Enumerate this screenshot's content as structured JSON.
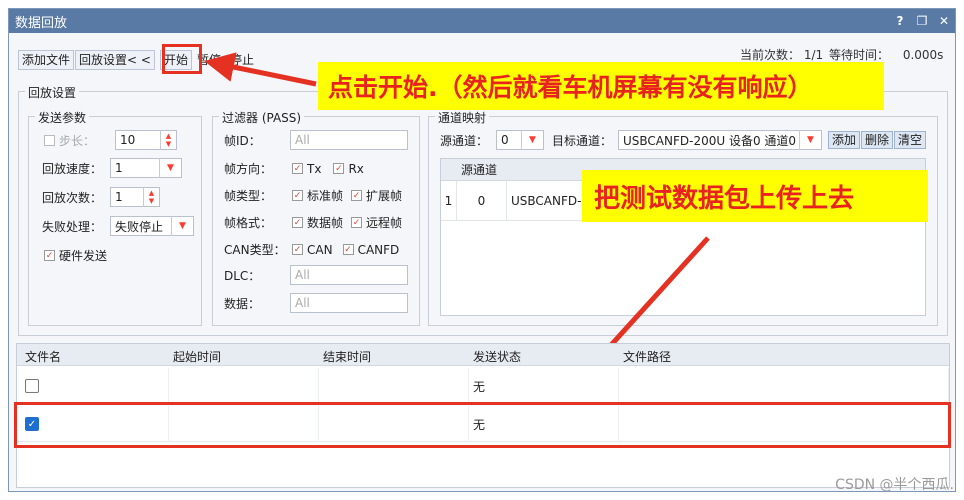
{
  "window": {
    "title": "数据回放",
    "help": "?",
    "restore": "❐",
    "close": "✕"
  },
  "toolbar": {
    "add_file": "添加文件",
    "replay_settings": "回放设置< <",
    "start": "开始",
    "pause": "暂停",
    "stop": "停止"
  },
  "status": {
    "label": "当前次数：",
    "value": "1/1",
    "wait_label": "等待时间：",
    "wait_value": "0.000s"
  },
  "replay_group": {
    "label": "回放设置"
  },
  "send_params": {
    "label": "发送参数",
    "step_label": "步长：",
    "step_value": "10",
    "speed_label": "回放速度：",
    "speed_value": "1",
    "count_label": "回放次数：",
    "count_value": "1",
    "fail_label": "失败处理：",
    "fail_value": "失败停止",
    "hw_send_label": "硬件发送"
  },
  "filter": {
    "label": "过滤器 (PASS)",
    "frame_id_label": "帧ID：",
    "frame_id_placeholder": "All",
    "direction_label": "帧方向：",
    "tx": "Tx",
    "rx": "Rx",
    "frame_type_label": "帧类型：",
    "standard": "标准帧",
    "extended": "扩展帧",
    "frame_format_label": "帧格式：",
    "data_frame": "数据帧",
    "remote_frame": "远程帧",
    "can_type_label": "CAN类型：",
    "can": "CAN",
    "canfd": "CANFD",
    "dlc_label": "DLC：",
    "dlc_placeholder": "All",
    "data_label": "数据：",
    "data_placeholder": "All"
  },
  "mapping": {
    "label": "通道映射",
    "source_label": "源通道：",
    "source_value": "0",
    "target_label": "目标通道：",
    "target_value": "USBCANFD-200U 设备0 通道0",
    "add": "添加",
    "delete": "删除",
    "clear": "清空",
    "column_source": "源通道",
    "row_index": "1",
    "row_source": "0",
    "row_target": "USBCANFD-2"
  },
  "files": {
    "columns": {
      "name": "文件名",
      "start": "起始时间",
      "end": "结束时间",
      "status": "发送状态",
      "path": "文件路径"
    },
    "rows": [
      {
        "status": "无",
        "checked": false
      },
      {
        "status": "无",
        "checked": true
      }
    ]
  },
  "annotations": {
    "click_start": "点击开始.（然后就看车机屏幕有没有响应）",
    "upload": "把测试数据包上传上去"
  },
  "watermark": "CSDN @半个西瓜.",
  "colors": {
    "annotation_red": "#e43121",
    "annotation_yellow": "#ffff00",
    "titlebar": "#5a7aa6",
    "checkbox_blue": "#1f6fd1"
  }
}
